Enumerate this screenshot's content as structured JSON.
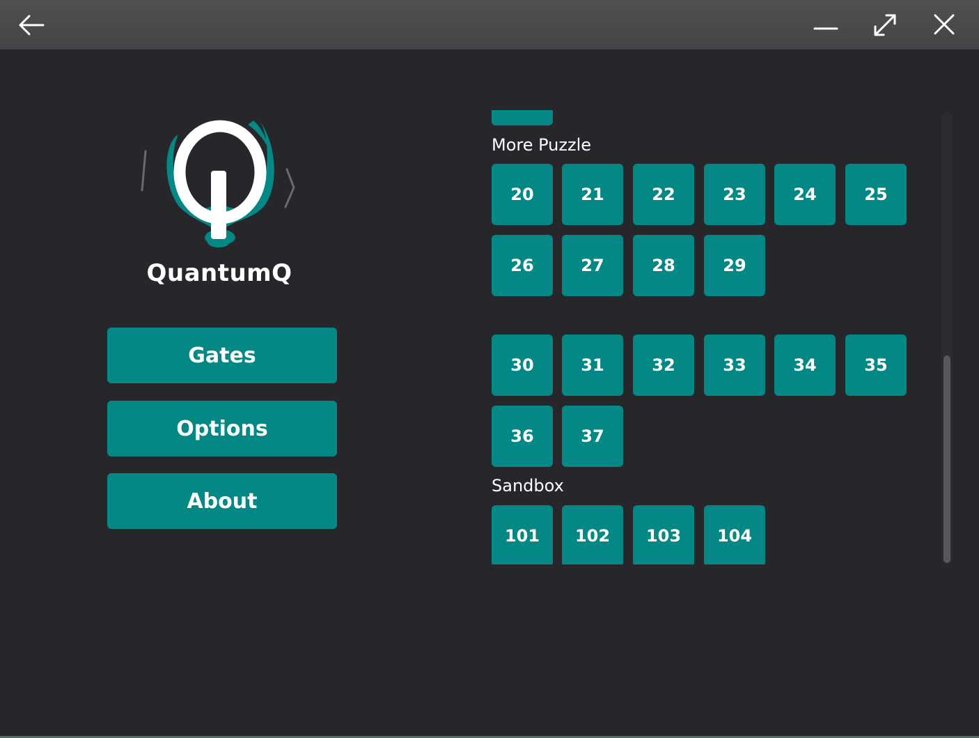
{
  "window": {
    "back_icon": "arrow-left-icon",
    "minimize_icon": "minimize-icon",
    "maximize_icon": "maximize-icon",
    "close_icon": "close-icon"
  },
  "app": {
    "title": "QuantumQ",
    "logo_icon": "quantumq-logo"
  },
  "menu": {
    "gates_label": "Gates",
    "options_label": "Options",
    "about_label": "About"
  },
  "sections": {
    "more_puzzle_label": "More Puzzle",
    "sandbox_label": "Sandbox"
  },
  "levels": {
    "more_puzzle_row1": [
      "20",
      "21",
      "22",
      "23",
      "24",
      "25"
    ],
    "more_puzzle_row2": [
      "26",
      "27",
      "28",
      "29"
    ],
    "group2_row1": [
      "30",
      "31",
      "32",
      "33",
      "34",
      "35"
    ],
    "group2_row2": [
      "36",
      "37"
    ],
    "sandbox": [
      "101",
      "102",
      "103",
      "104"
    ]
  },
  "colors": {
    "accent": "#038886",
    "background": "#27272b",
    "titlebar": "#4a4a4c",
    "text": "#ffffff"
  }
}
